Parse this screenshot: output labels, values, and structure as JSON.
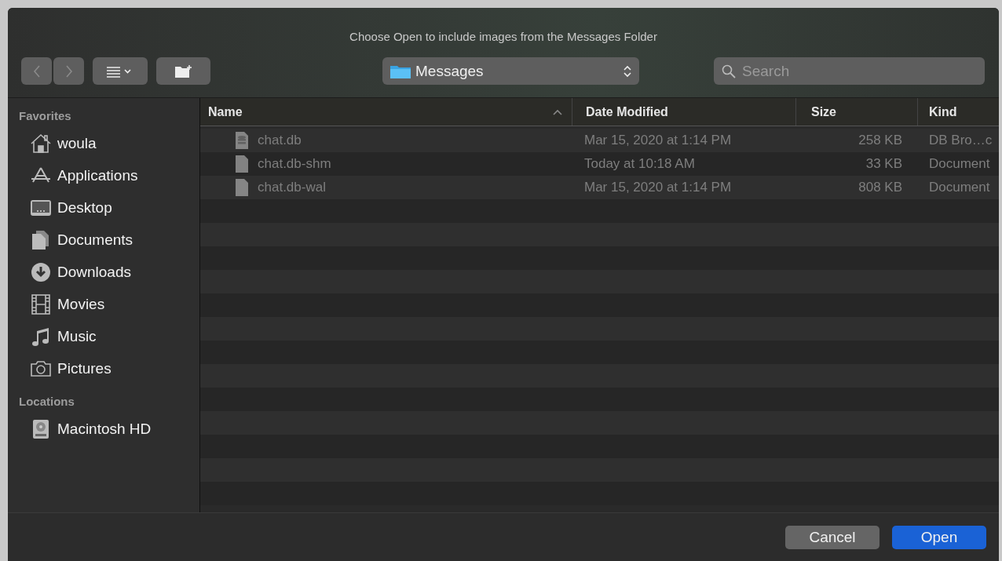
{
  "window": {
    "title": "Choose Open to include images from the Messages Folder"
  },
  "toolbar": {
    "back": {
      "disabled": true
    },
    "forward": {
      "disabled": true
    },
    "location": "Messages",
    "search": {
      "placeholder": "Search"
    }
  },
  "sidebar": {
    "sections": [
      {
        "heading": "Favorites",
        "items": [
          {
            "label": "woula",
            "kind": "home"
          },
          {
            "label": "Applications",
            "kind": "apps"
          },
          {
            "label": "Desktop",
            "kind": "desktop"
          },
          {
            "label": "Documents",
            "kind": "documents"
          },
          {
            "label": "Downloads",
            "kind": "downloads"
          },
          {
            "label": "Movies",
            "kind": "movies"
          },
          {
            "label": "Music",
            "kind": "music"
          },
          {
            "label": "Pictures",
            "kind": "pictures"
          }
        ]
      },
      {
        "heading": "Locations",
        "items": [
          {
            "label": "Macintosh HD",
            "kind": "disk"
          }
        ]
      }
    ]
  },
  "table": {
    "columns": [
      {
        "label": "Name",
        "sorted": true
      },
      {
        "label": "Date Modified",
        "sorted": false
      },
      {
        "label": "Size",
        "sorted": false
      },
      {
        "label": "Kind",
        "sorted": false
      }
    ],
    "rows": [
      {
        "name": "chat.db",
        "kind": "database",
        "disabled": true,
        "date": "Mar 15, 2020 at 1:14 PM",
        "size": "258 KB",
        "type": "DB Bro…c"
      },
      {
        "name": "chat.db-shm",
        "kind": "document",
        "disabled": true,
        "date": "Today at 10:18 AM",
        "size": "33 KB",
        "type": "Document"
      },
      {
        "name": "chat.db-wal",
        "kind": "document",
        "disabled": true,
        "date": "Mar 15, 2020 at 1:14 PM",
        "size": "808 KB",
        "type": "Document"
      }
    ]
  },
  "buttons": [
    {
      "label": "Cancel",
      "kind": "secondary"
    },
    {
      "label": "Open",
      "kind": "primary"
    }
  ]
}
